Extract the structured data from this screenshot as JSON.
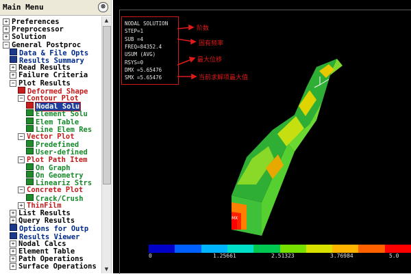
{
  "menu": {
    "title": "Main Menu",
    "collapse_glyph": "⊗",
    "items": [
      {
        "label": "Preferences",
        "toggle": "⊞",
        "icon": "none",
        "color": "black",
        "level": 0
      },
      {
        "label": "Preprocessor",
        "toggle": "⊞",
        "icon": "none",
        "color": "black",
        "level": 0
      },
      {
        "label": "Solution",
        "toggle": "⊞",
        "icon": "none",
        "color": "black",
        "level": 0
      },
      {
        "label": "General Postproc",
        "toggle": "⊟",
        "icon": "none",
        "color": "black",
        "level": 0
      },
      {
        "label": "Data & File Opts",
        "toggle": "",
        "icon": "navy",
        "color": "navy",
        "level": 1
      },
      {
        "label": "Results Summary",
        "toggle": "",
        "icon": "navy",
        "color": "navy",
        "level": 1
      },
      {
        "label": "Read Results",
        "toggle": "⊞",
        "icon": "none",
        "color": "black",
        "level": 1
      },
      {
        "label": "Failure Criteria",
        "toggle": "⊞",
        "icon": "none",
        "color": "black",
        "level": 1
      },
      {
        "label": "Plot Results",
        "toggle": "⊟",
        "icon": "none",
        "color": "black",
        "level": 1
      },
      {
        "label": "Deformed Shape",
        "toggle": "",
        "icon": "red",
        "color": "red",
        "level": 2
      },
      {
        "label": "Contour Plot",
        "toggle": "⊟",
        "icon": "none",
        "color": "red",
        "level": 2
      },
      {
        "label": "Nodal Solu",
        "toggle": "",
        "icon": "red",
        "color": "green",
        "level": 3,
        "selected": true
      },
      {
        "label": "Element Solu",
        "toggle": "",
        "icon": "green",
        "color": "green",
        "level": 3
      },
      {
        "label": "Elem Table",
        "toggle": "",
        "icon": "green",
        "color": "green",
        "level": 3
      },
      {
        "label": "Line Elem Res",
        "toggle": "",
        "icon": "green",
        "color": "green",
        "level": 3
      },
      {
        "label": "Vector Plot",
        "toggle": "⊟",
        "icon": "none",
        "color": "red",
        "level": 2
      },
      {
        "label": "Predefined",
        "toggle": "",
        "icon": "green",
        "color": "green",
        "level": 3
      },
      {
        "label": "User-defined",
        "toggle": "",
        "icon": "green",
        "color": "green",
        "level": 3
      },
      {
        "label": "Plot Path Item",
        "toggle": "⊟",
        "icon": "none",
        "color": "red",
        "level": 2
      },
      {
        "label": "On Graph",
        "toggle": "",
        "icon": "green",
        "color": "green",
        "level": 3
      },
      {
        "label": "On Geometry",
        "toggle": "",
        "icon": "green",
        "color": "green",
        "level": 3
      },
      {
        "label": "Lineariz Strs",
        "toggle": "",
        "icon": "green",
        "color": "green",
        "level": 3
      },
      {
        "label": "Concrete Plot",
        "toggle": "⊟",
        "icon": "none",
        "color": "red",
        "level": 2
      },
      {
        "label": "Crack/Crush",
        "toggle": "",
        "icon": "green",
        "color": "green",
        "level": 3
      },
      {
        "label": "ThinFilm",
        "toggle": "⊞",
        "icon": "none",
        "color": "red",
        "level": 2
      },
      {
        "label": "List Results",
        "toggle": "⊞",
        "icon": "none",
        "color": "black",
        "level": 1
      },
      {
        "label": "Query Results",
        "toggle": "⊞",
        "icon": "none",
        "color": "black",
        "level": 1
      },
      {
        "label": "Options for Outp",
        "toggle": "",
        "icon": "navy",
        "color": "navy",
        "level": 1
      },
      {
        "label": "Results Viewer",
        "toggle": "",
        "icon": "navy",
        "color": "navy",
        "level": 1
      },
      {
        "label": "Nodal Calcs",
        "toggle": "⊞",
        "icon": "none",
        "color": "black",
        "level": 1
      },
      {
        "label": "Element Table",
        "toggle": "⊞",
        "icon": "none",
        "color": "black",
        "level": 1
      },
      {
        "label": "Path Operations",
        "toggle": "⊞",
        "icon": "none",
        "color": "black",
        "level": 1
      },
      {
        "label": "Surface Operations",
        "toggle": "⊞",
        "icon": "none",
        "color": "black",
        "level": 1
      }
    ]
  },
  "graphics": {
    "legend_lines": [
      "NODAL SOLUTION",
      "STEP=1",
      "SUB =4",
      "FREQ=84352.4",
      "USUM     (AVG)",
      "RSYS=0",
      "DMX =5.65476",
      "SMX =5.65476"
    ],
    "annotations": [
      "阶数",
      "固有频率",
      "最大位移",
      "当前求解项最大值"
    ],
    "node_label": "MX",
    "colorbar": {
      "colors": [
        "#0000c8",
        "#0060ff",
        "#00b4ff",
        "#00e0c8",
        "#00c850",
        "#78e000",
        "#d8e000",
        "#ffb400",
        "#ff6000",
        "#ff0000"
      ],
      "ticks": [
        "0",
        "1.25661",
        "2.51323",
        "3.76984",
        "5.0"
      ]
    },
    "accent_red": "#e01a1a"
  }
}
